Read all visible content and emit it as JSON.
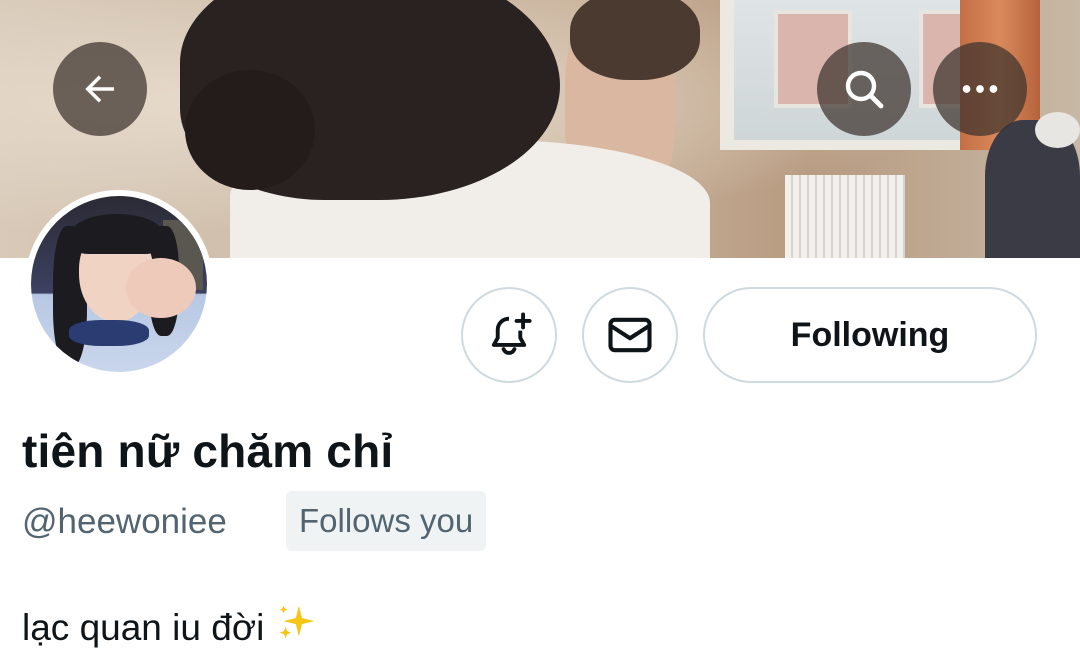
{
  "header": {
    "back_icon": "arrow-left-icon",
    "search_icon": "search-icon",
    "more_icon": "more-horizontal-icon"
  },
  "profile": {
    "display_name": "tiên nữ chăm chỉ",
    "handle": "@heewoniee",
    "follows_you_badge": "Follows you",
    "bio": "lạc quan iu đời",
    "bio_emoji": "sparkles-icon"
  },
  "actions": {
    "notify_icon": "bell-plus-icon",
    "message_icon": "envelope-icon",
    "following_label": "Following"
  },
  "colors": {
    "text_primary": "#0f1419",
    "text_secondary": "#536471",
    "border": "#cfd9de",
    "badge_bg": "#eff3f4",
    "sparkle": "#f5c518"
  }
}
